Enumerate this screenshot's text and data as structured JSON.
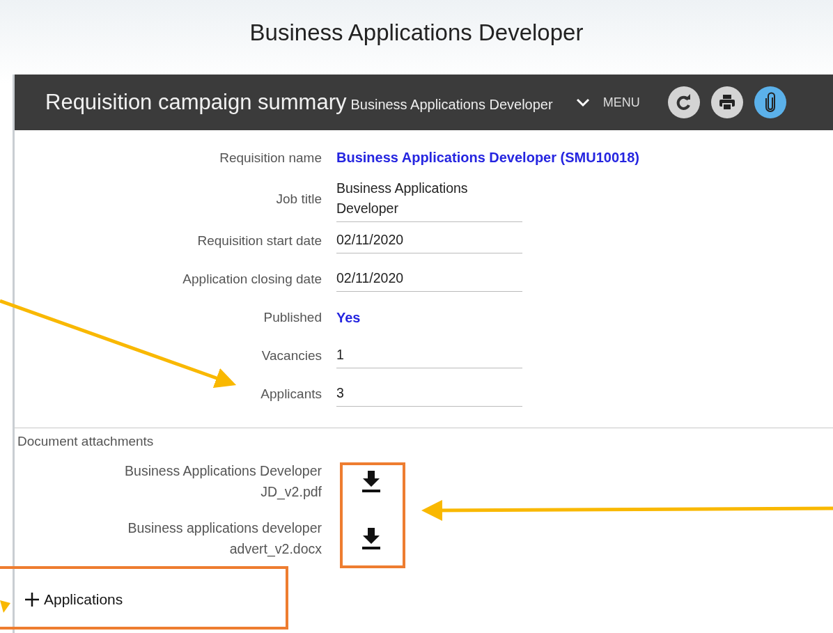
{
  "page_title": "Business Applications Developer",
  "header": {
    "title": "Requisition campaign summary",
    "subtitle": "Business Applications Developer",
    "menu": "MENU"
  },
  "fields": [
    {
      "label": "Requisition name",
      "value": "Business Applications Developer (SMU10018)",
      "kind": "link"
    },
    {
      "label": "Job title",
      "value": "Business Applications Developer",
      "kind": "field"
    },
    {
      "label": "Requisition start date",
      "value": "02/11/2020",
      "kind": "field"
    },
    {
      "label": "Application closing date",
      "value": "02/11/2020",
      "kind": "field"
    },
    {
      "label": "Published",
      "value": "Yes",
      "kind": "link"
    },
    {
      "label": "Vacancies",
      "value": "1",
      "kind": "field"
    },
    {
      "label": "Applicants",
      "value": "3",
      "kind": "field"
    }
  ],
  "attachments": {
    "title": "Document attachments",
    "files": [
      {
        "name": "Business Applications Developer JD_v2.pdf"
      },
      {
        "name": "Business applications developer advert_v2.docx"
      }
    ]
  },
  "applications": {
    "label": "Applications",
    "expanded": false
  }
}
